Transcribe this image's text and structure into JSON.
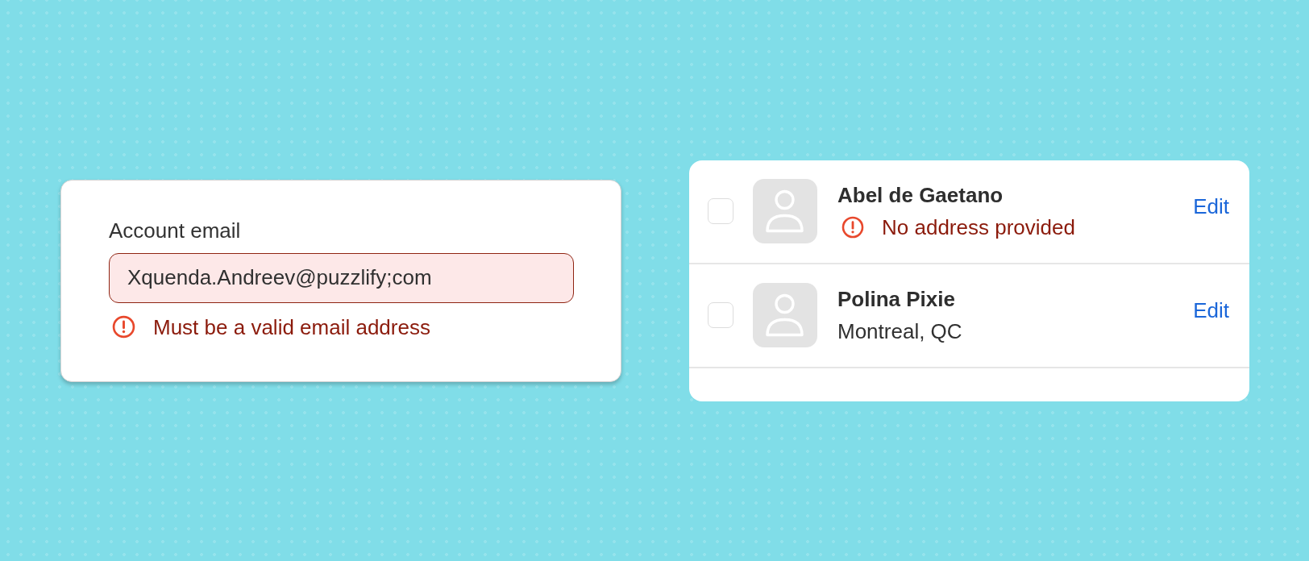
{
  "email_form": {
    "label": "Account email",
    "value": "Xquenda.Andreev@puzzlify;com",
    "invalid": true,
    "error": "Must be a valid email address"
  },
  "contact_list": {
    "rows": [
      {
        "checked": false,
        "name": "Abel de Gaetano",
        "detail": {
          "kind": "error",
          "text": "No address provided"
        },
        "action": "Edit"
      },
      {
        "checked": false,
        "name": "Polina Pixie",
        "detail": {
          "kind": "address",
          "text": "Montreal, QC"
        },
        "action": "Edit"
      }
    ]
  }
}
